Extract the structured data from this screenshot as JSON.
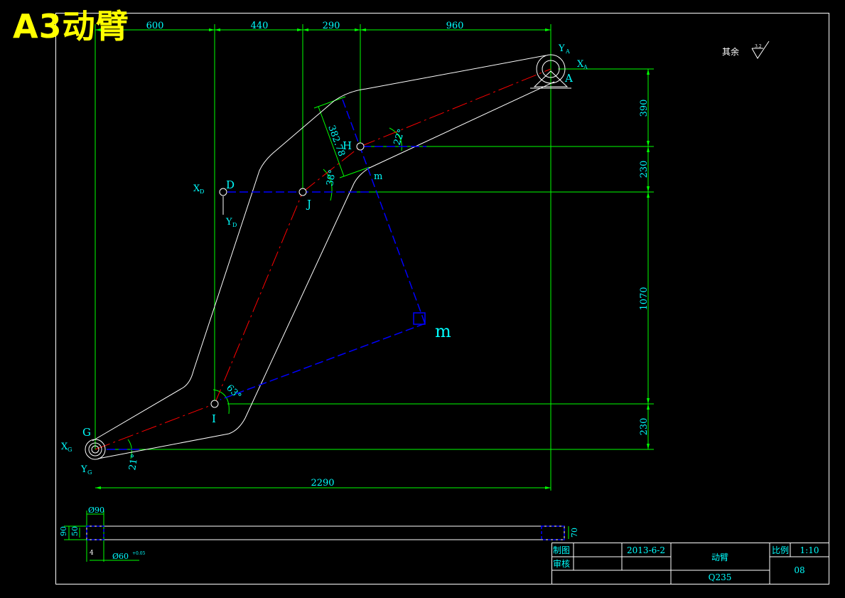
{
  "title": "A3动臂",
  "colors": {
    "dim": "#00ff00",
    "label": "#00ffff",
    "outline": "#ffffff",
    "red": "#ff0000",
    "blue": "#0000ff",
    "title": "#ffff00"
  },
  "dimensions": {
    "top": [
      "600",
      "440",
      "290",
      "960"
    ],
    "right": [
      "390",
      "230",
      "1070",
      "230"
    ],
    "bottom": "2290",
    "hd": "382.78"
  },
  "angles": {
    "a22": "22°",
    "a38": "38°",
    "a63": "63°",
    "a21": "21°"
  },
  "points": {
    "A": "A",
    "D": "D",
    "H": "H",
    "J": "J",
    "I": "I",
    "G": "G",
    "m": "m",
    "M": "m",
    "XA": "X",
    "XA_sub": "A",
    "YA": "Y",
    "YA_sub": "A",
    "XD": "X",
    "XD_sub": "D",
    "YD": "Y",
    "YD_sub": "D",
    "XG": "X",
    "XG_sub": "G",
    "YG": "Y",
    "YG_sub": "G"
  },
  "surface_note": "其余",
  "roughness": "3.2",
  "side_view": {
    "d90": "Ø90",
    "h90": "90",
    "h50": "50",
    "d60": "Ø60",
    "tol": "+0.05",
    "h70": "70",
    "small": "4"
  },
  "title_block": {
    "drawn_label": "制图",
    "checked_label": "审核",
    "date": "2013-6-2",
    "name": "动臂",
    "scale_label": "比例",
    "scale": "1:10",
    "material": "Q235",
    "number": "08"
  }
}
